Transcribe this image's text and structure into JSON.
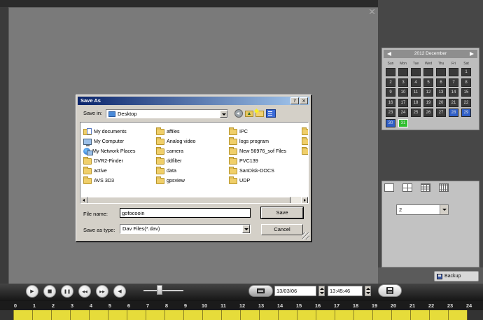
{
  "dialog": {
    "title": "Save As",
    "save_in_label": "Save in:",
    "save_in_value": "Desktop",
    "toolbar_icons": [
      "back-icon",
      "up-folder-icon",
      "new-folder-icon",
      "views-menu-icon"
    ],
    "files": [
      {
        "name": "My documents",
        "icon": "my-documents-icon"
      },
      {
        "name": "My Computer",
        "icon": "my-computer-icon"
      },
      {
        "name": "My Network Places",
        "icon": "my-network-icon"
      },
      {
        "name": "DVR2-Finder",
        "icon": "folder-icon"
      },
      {
        "name": "active",
        "icon": "folder-icon"
      },
      {
        "name": "AVS 3D3",
        "icon": "folder-icon"
      },
      {
        "name": "affiles",
        "icon": "folder-icon"
      },
      {
        "name": "Analog video",
        "icon": "folder-icon"
      },
      {
        "name": "camera",
        "icon": "folder-icon"
      },
      {
        "name": "ddfilter",
        "icon": "folder-icon"
      },
      {
        "name": "data",
        "icon": "folder-icon"
      },
      {
        "name": "gpsview",
        "icon": "folder-icon"
      },
      {
        "name": "IPC",
        "icon": "folder-icon"
      },
      {
        "name": "logs program",
        "icon": "folder-icon"
      },
      {
        "name": "New 56976_sof Files",
        "icon": "folder-icon"
      },
      {
        "name": "PVC139",
        "icon": "folder-icon"
      },
      {
        "name": "SanDisk-DOCS",
        "icon": "folder-icon"
      },
      {
        "name": "UDP",
        "icon": "folder-icon"
      }
    ],
    "partial_column": [
      {
        "icon": "folder-icon"
      },
      {
        "icon": "folder-icon"
      },
      {
        "icon": "folder-icon"
      }
    ],
    "file_name_label": "File name:",
    "file_name_value": "gofocooin",
    "save_as_type_label": "Save as type:",
    "save_as_type_value": "Dav Files(*.dav)",
    "save_button": "Save",
    "cancel_button": "Cancel"
  },
  "calendar": {
    "title": "2012 December",
    "weekdays": [
      "Sun",
      "Mon",
      "Tue",
      "Wed",
      "Thu",
      "Fri",
      "Sat"
    ],
    "days": [
      {
        "day": null,
        "state": "normal"
      },
      {
        "day": null,
        "state": "normal"
      },
      {
        "day": null,
        "state": "normal"
      },
      {
        "day": null,
        "state": "normal"
      },
      {
        "day": null,
        "state": "normal"
      },
      {
        "day": null,
        "state": "normal"
      },
      {
        "day": "1",
        "state": "normal"
      },
      {
        "day": "2",
        "state": "normal"
      },
      {
        "day": "3",
        "state": "normal"
      },
      {
        "day": "4",
        "state": "normal"
      },
      {
        "day": "5",
        "state": "normal"
      },
      {
        "day": "6",
        "state": "normal"
      },
      {
        "day": "7",
        "state": "normal"
      },
      {
        "day": "8",
        "state": "normal"
      },
      {
        "day": "9",
        "state": "normal"
      },
      {
        "day": "10",
        "state": "normal"
      },
      {
        "day": "11",
        "state": "normal"
      },
      {
        "day": "12",
        "state": "normal"
      },
      {
        "day": "13",
        "state": "normal"
      },
      {
        "day": "14",
        "state": "normal"
      },
      {
        "day": "15",
        "state": "normal"
      },
      {
        "day": "16",
        "state": "normal"
      },
      {
        "day": "17",
        "state": "normal"
      },
      {
        "day": "18",
        "state": "normal"
      },
      {
        "day": "19",
        "state": "normal"
      },
      {
        "day": "20",
        "state": "normal"
      },
      {
        "day": "21",
        "state": "normal"
      },
      {
        "day": "22",
        "state": "normal"
      },
      {
        "day": "23",
        "state": "normal"
      },
      {
        "day": "24",
        "state": "normal"
      },
      {
        "day": "25",
        "state": "normal"
      },
      {
        "day": "26",
        "state": "normal"
      },
      {
        "day": "27",
        "state": "normal"
      },
      {
        "day": "28",
        "state": "record"
      },
      {
        "day": "29",
        "state": "record"
      },
      {
        "day": "30",
        "state": "record"
      },
      {
        "day": "31",
        "state": "selected"
      }
    ]
  },
  "layout": {
    "split_icons": [
      "split-1-icon",
      "split-4-icon",
      "split-9-icon",
      "split-16-icon"
    ],
    "channel_value": "2"
  },
  "backup_button": "Backup",
  "playback": {
    "controls": [
      {
        "name": "play-button",
        "icon": "play-icon"
      },
      {
        "name": "stop-button",
        "icon": "stop-icon"
      },
      {
        "name": "pause-button",
        "icon": "pause-icon"
      },
      {
        "name": "slow-button",
        "icon": "slow-icon"
      },
      {
        "name": "fast-button",
        "icon": "fast-icon"
      },
      {
        "name": "audio-button",
        "icon": "speaker-icon"
      }
    ],
    "volume": 0.4,
    "date": "13/03/06",
    "time": "13:45:46"
  },
  "timeline": {
    "hours": [
      "0",
      "1",
      "2",
      "3",
      "4",
      "5",
      "6",
      "7",
      "8",
      "9",
      "10",
      "11",
      "12",
      "13",
      "14",
      "15",
      "16",
      "17",
      "18",
      "19",
      "20",
      "21",
      "22",
      "23",
      "24"
    ],
    "recorded": [
      [
        0,
        24
      ]
    ]
  },
  "colors": {
    "record_bar": "#e6dc3a",
    "calendar_day": "#3a3a3a",
    "calendar_record": "#2f5fc8",
    "calendar_selected": "#2fbf2f"
  }
}
